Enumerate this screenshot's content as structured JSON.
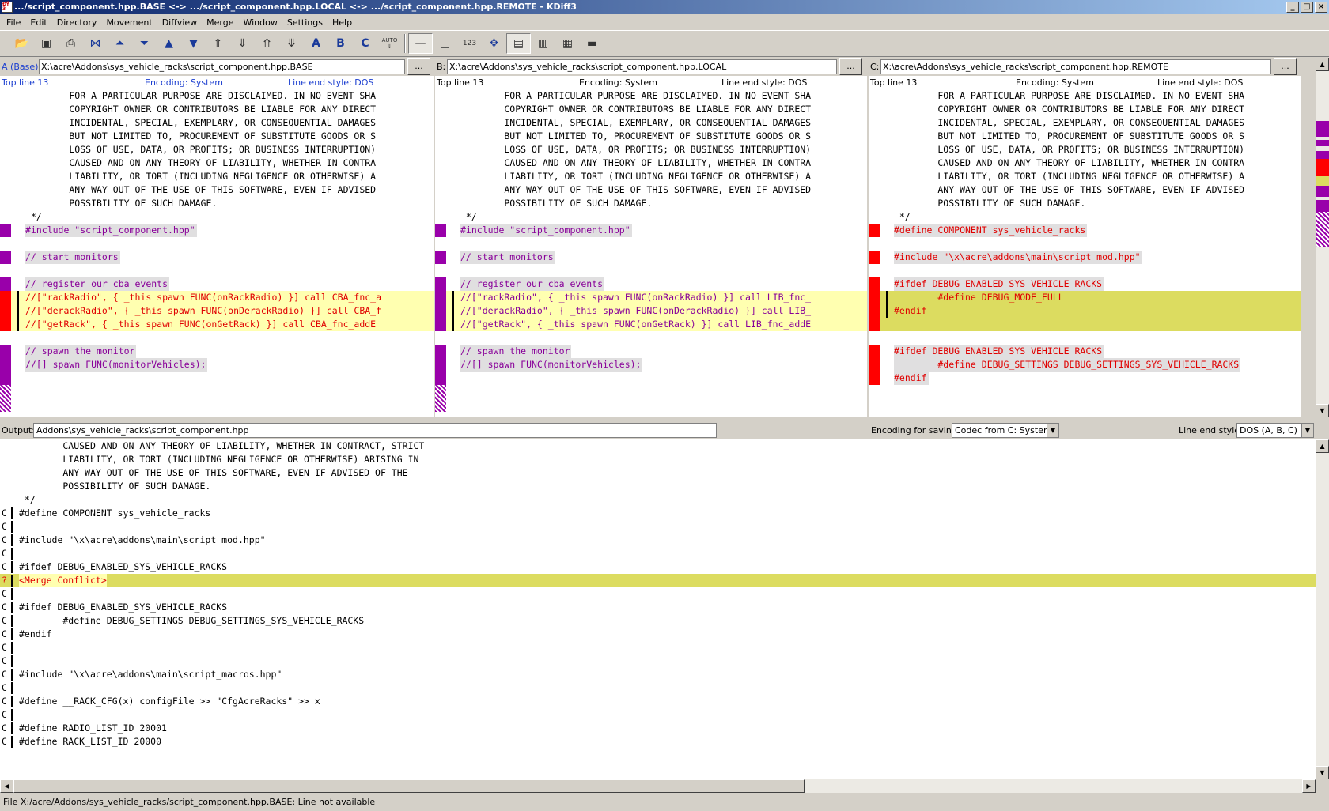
{
  "window": {
    "title": ".../script_component.hpp.BASE <-> .../script_component.hpp.LOCAL <-> .../script_component.hpp.REMOTE - KDiff3"
  },
  "menu": [
    "File",
    "Edit",
    "Directory",
    "Movement",
    "Diffview",
    "Merge",
    "Window",
    "Settings",
    "Help"
  ],
  "toolbar": {
    "icons": [
      "open-icon",
      "save-icon",
      "print-icon",
      "go-current-icon",
      "go-top-icon",
      "go-bottom-icon",
      "go-prev-delta-icon",
      "go-next-delta-icon",
      "go-prev-conflict-icon",
      "go-next-conflict-icon",
      "go-prev-unsolved-icon",
      "go-next-unsolved-icon",
      "choose-a-icon",
      "choose-b-icon",
      "choose-c-icon",
      "auto-advance-icon",
      "show-whitespace-icon",
      "show-whitespace-chars-icon",
      "line-numbers-icon",
      "overview-icon",
      "layout-icon",
      "split-icon",
      "split-horizontal-icon",
      "toggle-icon"
    ],
    "auto_label": "AUTO",
    "numbers_label": "123",
    "a_label": "A",
    "b_label": "B",
    "c_label": "C"
  },
  "pane_a": {
    "label": "A (Base):",
    "path": "X:\\acre\\Addons\\sys_vehicle_racks\\script_component.hpp.BASE",
    "browse": "...",
    "top_line": "Top line 13",
    "encoding": "Encoding: System",
    "line_end": "Line end style: DOS",
    "lines": [
      "        FOR A PARTICULAR PURPOSE ARE DISCLAIMED. IN NO EVENT SHA",
      "        COPYRIGHT OWNER OR CONTRIBUTORS BE LIABLE FOR ANY DIRECT",
      "        INCIDENTAL, SPECIAL, EXEMPLARY, OR CONSEQUENTIAL DAMAGES",
      "        BUT NOT LIMITED TO, PROCUREMENT OF SUBSTITUTE GOODS OR S",
      "        LOSS OF USE, DATA, OR PROFITS; OR BUSINESS INTERRUPTION)",
      "        CAUSED AND ON ANY THEORY OF LIABILITY, WHETHER IN CONTRA",
      "        LIABILITY, OR TORT (INCLUDING NEGLIGENCE OR OTHERWISE) A",
      "        ANY WAY OUT OF THE USE OF THIS SOFTWARE, EVEN IF ADVISED",
      "        POSSIBILITY OF SUCH DAMAGE.",
      " */",
      "#include \"script_component.hpp\"",
      "",
      "// start monitors",
      "",
      "// register our cba events",
      "//[\"rackRadio\", { _this spawn FUNC(onRackRadio) }] call CBA_fnc_a",
      "//[\"derackRadio\", { _this spawn FUNC(onDerackRadio) }] call CBA_f",
      "//[\"getRack\", { _this spawn FUNC(onGetRack) }] call CBA_fnc_addE",
      "",
      "// spawn the monitor",
      "//[] spawn FUNC(monitorVehicles);"
    ]
  },
  "pane_b": {
    "label": "B:",
    "path": "X:\\acre\\Addons\\sys_vehicle_racks\\script_component.hpp.LOCAL",
    "browse": "...",
    "top_line": "Top line 13",
    "encoding": "Encoding: System",
    "line_end": "Line end style: DOS",
    "lines": [
      "        FOR A PARTICULAR PURPOSE ARE DISCLAIMED. IN NO EVENT SHA",
      "        COPYRIGHT OWNER OR CONTRIBUTORS BE LIABLE FOR ANY DIRECT",
      "        INCIDENTAL, SPECIAL, EXEMPLARY, OR CONSEQUENTIAL DAMAGES",
      "        BUT NOT LIMITED TO, PROCUREMENT OF SUBSTITUTE GOODS OR S",
      "        LOSS OF USE, DATA, OR PROFITS; OR BUSINESS INTERRUPTION)",
      "        CAUSED AND ON ANY THEORY OF LIABILITY, WHETHER IN CONTRA",
      "        LIABILITY, OR TORT (INCLUDING NEGLIGENCE OR OTHERWISE) A",
      "        ANY WAY OUT OF THE USE OF THIS SOFTWARE, EVEN IF ADVISED",
      "        POSSIBILITY OF SUCH DAMAGE.",
      " */",
      "#include \"script_component.hpp\"",
      "",
      "// start monitors",
      "",
      "// register our cba events",
      "//[\"rackRadio\", { _this spawn FUNC(onRackRadio) }] call LIB_fnc_",
      "//[\"derackRadio\", { _this spawn FUNC(onDerackRadio) }] call LIB_",
      "//[\"getRack\", { _this spawn FUNC(onGetRack) }] call LIB_fnc_addE",
      "",
      "// spawn the monitor",
      "//[] spawn FUNC(monitorVehicles);"
    ]
  },
  "pane_c": {
    "label": "C:",
    "path": "X:\\acre\\Addons\\sys_vehicle_racks\\script_component.hpp.REMOTE",
    "browse": "...",
    "top_line": "Top line 13",
    "encoding": "Encoding: System",
    "line_end": "Line end style: DOS",
    "lines": [
      "        FOR A PARTICULAR PURPOSE ARE DISCLAIMED. IN NO EVENT SHA",
      "        COPYRIGHT OWNER OR CONTRIBUTORS BE LIABLE FOR ANY DIRECT",
      "        INCIDENTAL, SPECIAL, EXEMPLARY, OR CONSEQUENTIAL DAMAGES",
      "        BUT NOT LIMITED TO, PROCUREMENT OF SUBSTITUTE GOODS OR S",
      "        LOSS OF USE, DATA, OR PROFITS; OR BUSINESS INTERRUPTION)",
      "        CAUSED AND ON ANY THEORY OF LIABILITY, WHETHER IN CONTRA",
      "        LIABILITY, OR TORT (INCLUDING NEGLIGENCE OR OTHERWISE) A",
      "        ANY WAY OUT OF THE USE OF THIS SOFTWARE, EVEN IF ADVISED",
      "        POSSIBILITY OF SUCH DAMAGE.",
      " */",
      "#define COMPONENT sys_vehicle_racks",
      "",
      "#include \"\\x\\acre\\addons\\main\\script_mod.hpp\"",
      "",
      "#ifdef DEBUG_ENABLED_SYS_VEHICLE_RACKS",
      "        #define DEBUG_MODE_FULL",
      "#endif",
      "",
      "",
      "#ifdef DEBUG_ENABLED_SYS_VEHICLE_RACKS",
      "        #define DEBUG_SETTINGS DEBUG_SETTINGS_SYS_VEHICLE_RACKS",
      "#endif"
    ]
  },
  "output_bar": {
    "label": "Output:",
    "path": "Addons\\sys_vehicle_racks\\script_component.hpp",
    "encoding_label": "Encoding for saving:",
    "encoding_value": "Codec from C: System",
    "line_end_label": "Line end style:",
    "line_end_value": "DOS (A, B, C)"
  },
  "output": {
    "lines": [
      {
        "mark": "",
        "text": "        CAUSED AND ON ANY THEORY OF LIABILITY, WHETHER IN CONTRACT, STRICT"
      },
      {
        "mark": "",
        "text": "        LIABILITY, OR TORT (INCLUDING NEGLIGENCE OR OTHERWISE) ARISING IN"
      },
      {
        "mark": "",
        "text": "        ANY WAY OUT OF THE USE OF THIS SOFTWARE, EVEN IF ADVISED OF THE"
      },
      {
        "mark": "",
        "text": "        POSSIBILITY OF SUCH DAMAGE."
      },
      {
        "mark": "",
        "text": " */"
      },
      {
        "mark": "C",
        "text": "#define COMPONENT sys_vehicle_racks"
      },
      {
        "mark": "C",
        "text": ""
      },
      {
        "mark": "C",
        "text": "#include \"\\x\\acre\\addons\\main\\script_mod.hpp\""
      },
      {
        "mark": "C",
        "text": ""
      },
      {
        "mark": "C",
        "text": "#ifdef DEBUG_ENABLED_SYS_VEHICLE_RACKS"
      },
      {
        "mark": "?",
        "text": "<Merge Conflict>"
      },
      {
        "mark": "C",
        "text": ""
      },
      {
        "mark": "C",
        "text": "#ifdef DEBUG_ENABLED_SYS_VEHICLE_RACKS"
      },
      {
        "mark": "C",
        "text": "        #define DEBUG_SETTINGS DEBUG_SETTINGS_SYS_VEHICLE_RACKS"
      },
      {
        "mark": "C",
        "text": "#endif"
      },
      {
        "mark": "C",
        "text": ""
      },
      {
        "mark": "C",
        "text": ""
      },
      {
        "mark": "C",
        "text": "#include \"\\x\\acre\\addons\\main\\script_macros.hpp\""
      },
      {
        "mark": "C",
        "text": ""
      },
      {
        "mark": "C",
        "text": "#define __RACK_CFG(x) configFile >> \"CfgAcreRacks\" >> x"
      },
      {
        "mark": "C",
        "text": ""
      },
      {
        "mark": "C",
        "text": "#define RADIO_LIST_ID 20001"
      },
      {
        "mark": "C",
        "text": "#define RACK_LIST_ID 20000"
      }
    ]
  },
  "status": "File X:/acre/Addons/sys_vehicle_racks/script_component.hpp.BASE: Line not available",
  "colors": {
    "changed_ab": "#9900aa",
    "changed_c": "#ff0000",
    "conflict": "#dcdc60"
  }
}
